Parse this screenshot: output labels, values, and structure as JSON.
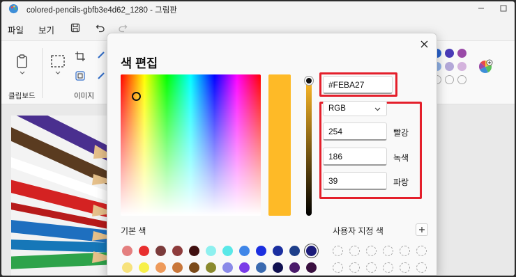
{
  "window": {
    "title": "colored-pencils-gbfb3e4d62_1280 - 그림판"
  },
  "menu": {
    "file": "파일",
    "view": "보기"
  },
  "ribbon": {
    "clipboard_label": "클립보드",
    "image_label": "이미지"
  },
  "ribbon_palette": [
    "#2a64cf",
    "#4a3bb7",
    "#9a4aa8",
    "#8fb2e8",
    "#b3a8d8",
    "#d4b3dd"
  ],
  "dialog": {
    "title": "색 편집",
    "selected_color": "#FEBA27",
    "hex_value": "#FEBA27",
    "mode_value": "RGB",
    "red_value": "254",
    "red_label": "빨강",
    "green_value": "186",
    "green_label": "녹색",
    "blue_value": "39",
    "blue_label": "파랑",
    "basic_colors_label": "기본 색",
    "custom_colors_label": "사용자 지정 색",
    "basic_colors_row1": [
      "#e47f7f",
      "#e82f2f",
      "#7b3b3b",
      "#8e3c3c",
      "#401010",
      "#8ef0ef",
      "#5ae8e8",
      "#3f86e8",
      "#1b2fe0",
      "#1b2fa0",
      "#1e3f8a",
      "#1b1b7a"
    ],
    "basic_colors_row2": [
      "#f7e27c",
      "#f7f04a",
      "#ee9a5a",
      "#c9773a",
      "#7a4a1a",
      "#8a8a2e",
      "#8a8ae8",
      "#7a3be8",
      "#3a6ab0",
      "#111151",
      "#4a1a6a",
      "#3a1040"
    ]
  }
}
